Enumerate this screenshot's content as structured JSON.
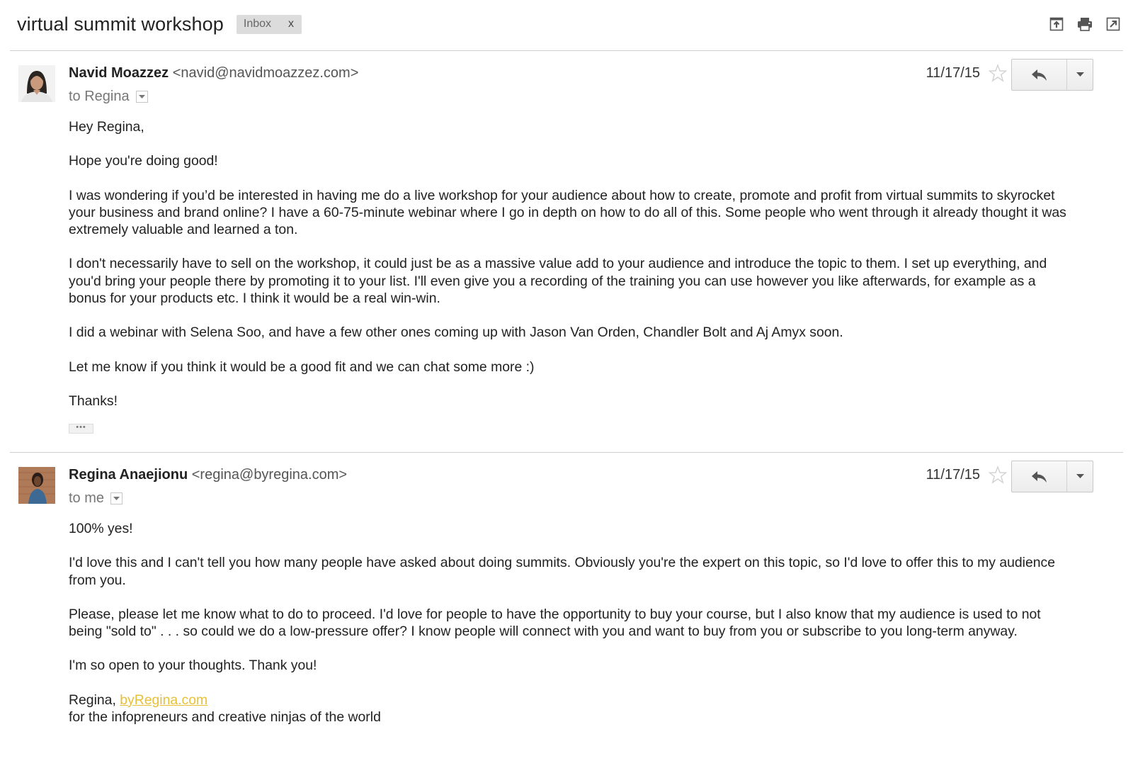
{
  "thread": {
    "subject": "virtual summit workshop",
    "label": "Inbox",
    "label_remove": "x",
    "actions": [
      {
        "icon": "archive-icon"
      },
      {
        "icon": "print-icon"
      },
      {
        "icon": "open-new-window-icon"
      }
    ]
  },
  "messages": [
    {
      "sender_name": "Navid Moazzez",
      "sender_email": "<navid@navidmoazzez.com>",
      "recipient": "to Regina",
      "date": "11/17/15",
      "paragraphs": [
        "Hey Regina,",
        "Hope you're doing good!",
        "I was wondering if you’d be interested in having me do a live workshop for your audience about how to create, promote and profit from virtual summits to skyrocket your business and brand online? I have a 60-75-minute webinar where I go in depth on how to do all of this. Some people who went through it already thought it was extremely valuable and learned a ton.",
        "I don't necessarily have to sell on the workshop, it could just be as a massive value add to your audience and introduce the topic to them. I set up everything, and you'd bring your people there by promoting it to your list. I'll even give you a recording of the training you can use however you like afterwards, for example as a bonus for your products etc. I think it would be a real win-win.",
        "I did a webinar with Selena Soo, and have a few other ones coming up with Jason Van Orden, Chandler Bolt and Aj Amyx soon.",
        "Let me know if you think it would be a good fit and we can chat some more :)",
        "Thanks!"
      ],
      "trimmed_toggle": "•••"
    },
    {
      "sender_name": "Regina Anaejionu",
      "sender_email": "<regina@byregina.com>",
      "recipient": "to me",
      "date": "11/17/15",
      "paragraphs": [
        "100% yes!",
        "I'd love this and I can't tell you how many people have asked about doing summits. Obviously you're the expert on this topic, so I'd love to offer this to my audience from you.",
        "Please, please let me know what to do to proceed. I'd love for people to have the opportunity to buy your course, but I also know that my audience is used to not being \"sold to\" . . . so could we do a low-pressure offer? I know people will connect with you and want to buy from you or subscribe to you long-term anyway.",
        "I'm so open to your thoughts. Thank you!"
      ],
      "signature": {
        "name_prefix": "Regina, ",
        "link_text": "byRegina.com",
        "tagline": "for the infopreneurs and creative ninjas of the world"
      }
    }
  ],
  "colors": {
    "link": "#e8c038",
    "divider": "#cfcfcf",
    "label_bg": "#dcdcdc"
  }
}
